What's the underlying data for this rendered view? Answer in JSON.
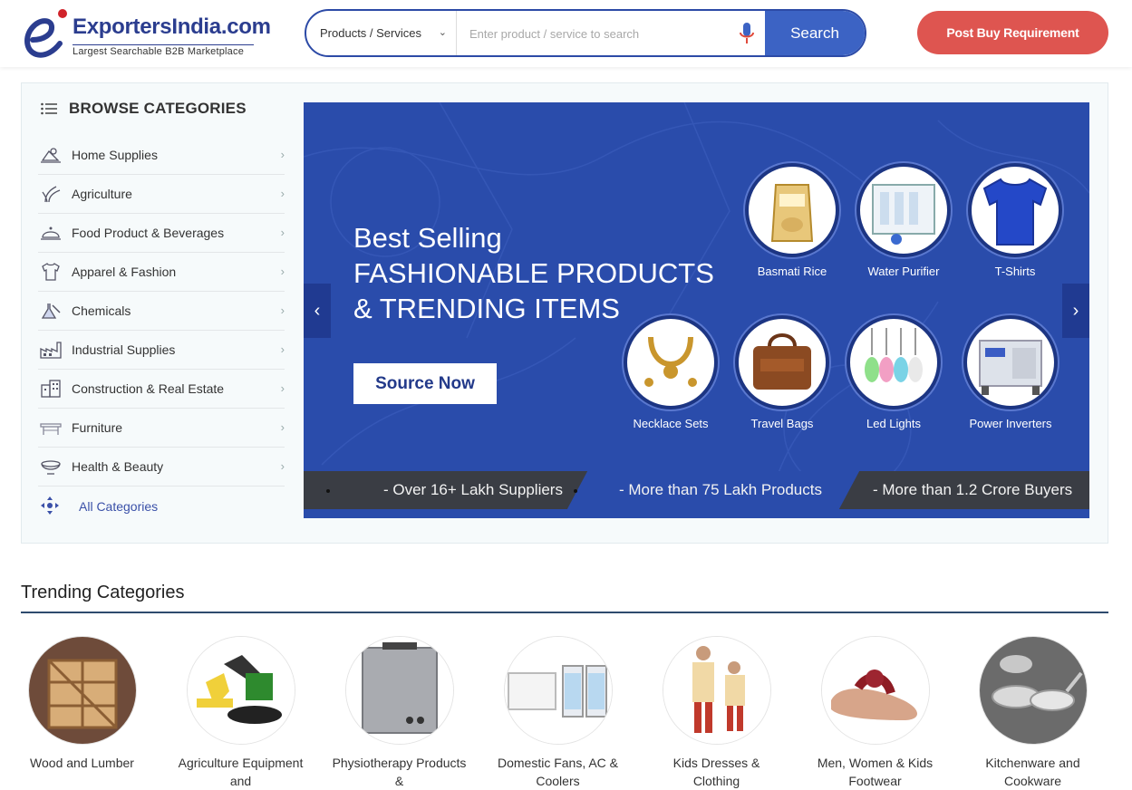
{
  "header": {
    "logo": {
      "brand": "ExportersIndia.com",
      "tagline": "Largest Searchable B2B Marketplace"
    },
    "search": {
      "category_selected": "Products / Services",
      "placeholder": "Enter product / service to search",
      "button_label": "Search"
    },
    "post_button_label": "Post Buy Requirement"
  },
  "sidebar": {
    "title": "BROWSE CATEGORIES",
    "items": [
      {
        "label": "Home Supplies",
        "icon": "home-supplies-icon"
      },
      {
        "label": "Agriculture",
        "icon": "agriculture-icon"
      },
      {
        "label": "Food Product & Beverages",
        "icon": "food-cloche-icon"
      },
      {
        "label": "Apparel & Fashion",
        "icon": "shirt-icon"
      },
      {
        "label": "Chemicals",
        "icon": "chemicals-flask-icon"
      },
      {
        "label": "Industrial Supplies",
        "icon": "factory-icon"
      },
      {
        "label": "Construction & Real Estate",
        "icon": "building-icon"
      },
      {
        "label": "Furniture",
        "icon": "table-icon"
      },
      {
        "label": "Health & Beauty",
        "icon": "bowl-icon"
      }
    ],
    "all_label": "All Categories"
  },
  "banner": {
    "headline_1": "Best Selling",
    "headline_2": "FASHIONABLE PRODUCTS",
    "headline_3": "& TRENDING ITEMS",
    "cta_label": "Source Now",
    "products": [
      {
        "label": "Basmati Rice"
      },
      {
        "label": "Water Purifier"
      },
      {
        "label": "T-Shirts"
      },
      {
        "label": "Necklace Sets"
      },
      {
        "label": "Travel Bags"
      },
      {
        "label": "Led Lights"
      },
      {
        "label": "Power Inverters"
      }
    ],
    "stats": [
      "- Over 16+ Lakh Suppliers",
      "- More than 75 Lakh Products",
      "- More than 1.2 Crore Buyers"
    ],
    "colors": {
      "banner_bg": "#2a4cab",
      "stats_bg": "#3a3d44"
    }
  },
  "trending": {
    "title": "Trending Categories",
    "items": [
      {
        "label": "Wood and Lumber"
      },
      {
        "label": "Agriculture Equipment and"
      },
      {
        "label": "Physiotherapy Products &"
      },
      {
        "label": "Domestic Fans, AC & Coolers"
      },
      {
        "label": "Kids Dresses & Clothing"
      },
      {
        "label": "Men, Women & Kids Footwear"
      },
      {
        "label": "Kitchenware and Cookware"
      }
    ]
  },
  "colors": {
    "brand_blue": "#2b3d8f",
    "search_button": "#3c63c4",
    "post_button": "#de5550",
    "logo_dot": "#d0232a"
  }
}
